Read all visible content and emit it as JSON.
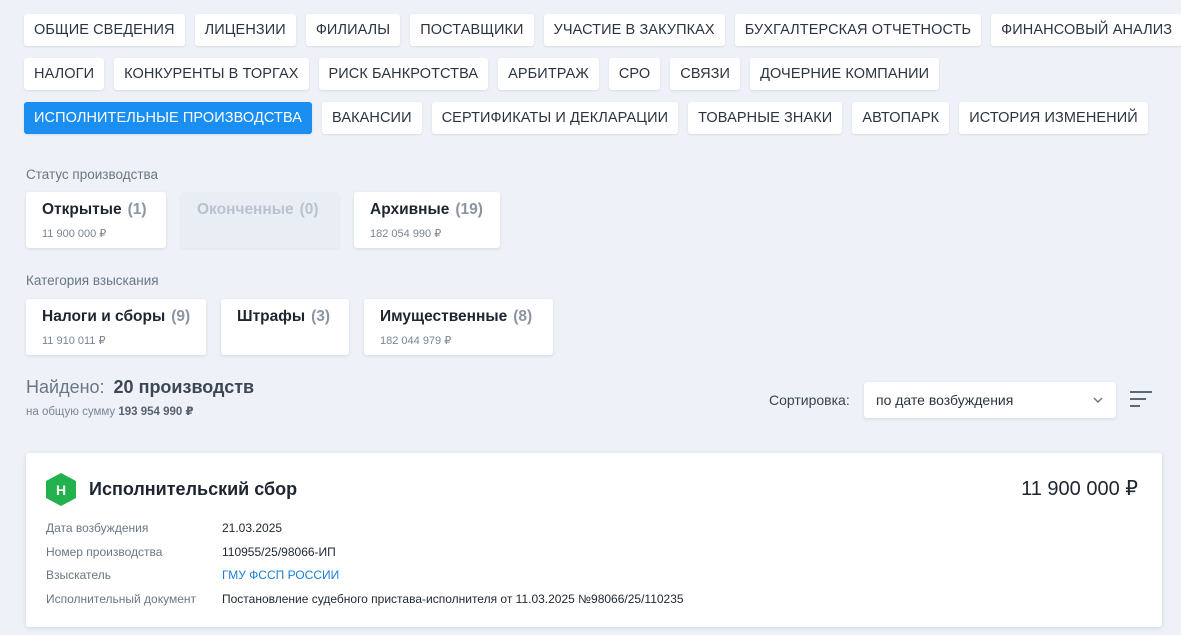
{
  "tabs": {
    "row1": [
      "ОБЩИЕ СВЕДЕНИЯ",
      "ЛИЦЕНЗИИ",
      "ФИЛИАЛЫ",
      "ПОСТАВЩИКИ",
      "УЧАСТИЕ В ЗАКУПКАХ",
      "БУХГАЛТЕРСКАЯ ОТЧЕТНОСТЬ",
      "ФИНАНСОВЫЙ АНАЛИЗ"
    ],
    "row2": [
      "НАЛОГИ",
      "КОНКУРЕНТЫ В ТОРГАХ",
      "РИСК БАНКРОТСТВА",
      "АРБИТРАЖ",
      "СРО",
      "СВЯЗИ",
      "ДОЧЕРНИЕ КОМПАНИИ"
    ],
    "row3": [
      "ИСПОЛНИТЕЛЬНЫЕ ПРОИЗВОДСТВА",
      "ВАКАНСИИ",
      "СЕРТИФИКАТЫ И ДЕКЛАРАЦИИ",
      "ТОВАРНЫЕ ЗНАКИ",
      "АВТОПАРК",
      "ИСТОРИЯ ИЗМЕНЕНИЙ"
    ],
    "active": "ИСПОЛНИТЕЛЬНЫЕ ПРОИЗВОДСТВА"
  },
  "status": {
    "label": "Статус производства",
    "cards": [
      {
        "title": "Открытые",
        "count": "(1)",
        "sum": "11 900 000 ₽"
      },
      {
        "title": "Оконченные",
        "count": "(0)",
        "sum": ""
      },
      {
        "title": "Архивные",
        "count": "(19)",
        "sum": "182 054 990 ₽"
      }
    ]
  },
  "category": {
    "label": "Категория взыскания",
    "cards": [
      {
        "title": "Налоги и сборы",
        "count": "(9)",
        "sum": "11 910 011 ₽"
      },
      {
        "title": "Штрафы",
        "count": "(3)",
        "sum": ""
      },
      {
        "title": "Имущественные",
        "count": "(8)",
        "sum": "182 044 979 ₽"
      }
    ]
  },
  "found": {
    "prefix": "Найдено:",
    "count_text": "20 производств",
    "sum_prefix": "на общую сумму",
    "sum": "193 954 990 ₽"
  },
  "sort": {
    "label": "Сортировка:",
    "value": "по дате возбуждения",
    "icon": "chevron-down-icon",
    "order_icon": "sort-lines-icon"
  },
  "record": {
    "badge": "Н",
    "badge_color": "#22b14c",
    "title": "Исполнительский сбор",
    "amount": "11 900 000 ₽",
    "fields": [
      {
        "label": "Дата возбуждения",
        "value": "21.03.2025"
      },
      {
        "label": "Номер производства",
        "value": "110955/25/98066-ИП"
      },
      {
        "label": "Взыскатель",
        "value": "ГМУ ФССП РОССИИ"
      },
      {
        "label": "Исполнительный документ",
        "value": "Постановление судебного пристава-исполнителя от 11.03.2025 №98066/25/110235"
      }
    ]
  },
  "colors": {
    "accent": "#1b8ef2",
    "background": "#eef2f8",
    "link": "#1b7fd8"
  }
}
